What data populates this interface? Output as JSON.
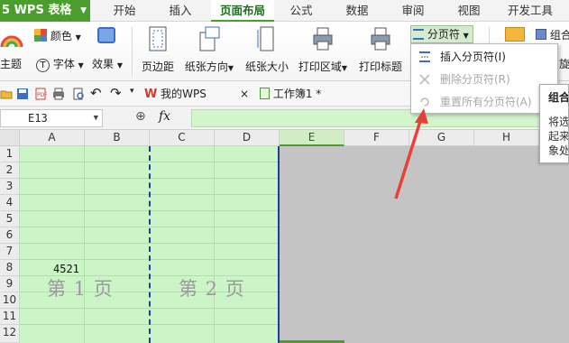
{
  "menubar": {
    "app_title": "5 WPS 表格",
    "tabs": [
      "开始",
      "插入",
      "页面布局",
      "公式",
      "数据",
      "审阅",
      "视图",
      "开发工具"
    ],
    "active_tab": "页面布局"
  },
  "ribbon": {
    "color_label": "颜色",
    "theme_label": "主题",
    "font_label": "字体",
    "effect_label": "效果",
    "margin_label": "页边距",
    "orientation_label": "纸张方向",
    "size_label": "纸张大小",
    "print_area_label": "打印区域",
    "print_title_label": "打印标题",
    "pagebreak_label": "分页符",
    "group_label": "组合",
    "rotate_label": "旋转"
  },
  "pagebreak_menu": {
    "items": [
      {
        "label": "插入分页符(I)",
        "enabled": true
      },
      {
        "label": "删除分页符(R)",
        "enabled": false
      },
      {
        "label": "重置所有分页符(A)",
        "enabled": false
      }
    ]
  },
  "tooltip": {
    "title": "组合",
    "lines": [
      "将选",
      "起来",
      "象处"
    ]
  },
  "doc_tabs": {
    "home_label": "我的WPS",
    "workbook_label": "工作簿1 *"
  },
  "formula_bar": {
    "cell_ref": "E13",
    "fx_label": "fx",
    "value": ""
  },
  "grid": {
    "columns": [
      "A",
      "B",
      "C",
      "D",
      "E",
      "F",
      "G",
      "H"
    ],
    "selected_column": "E",
    "rows": [
      "1",
      "2",
      "3",
      "4",
      "5",
      "6",
      "7",
      "8",
      "9",
      "10",
      "11",
      "12"
    ],
    "cell_A8": "4521",
    "page_labels": [
      "第 1 页",
      "第 2 页"
    ]
  },
  "colors": {
    "accent": "#4b9e2d",
    "print_area_fill": "#ccf5c7",
    "page_break_line": "#1f3fa0",
    "non_print_area": "#c4c4c4",
    "arrow": "#e8413a"
  }
}
